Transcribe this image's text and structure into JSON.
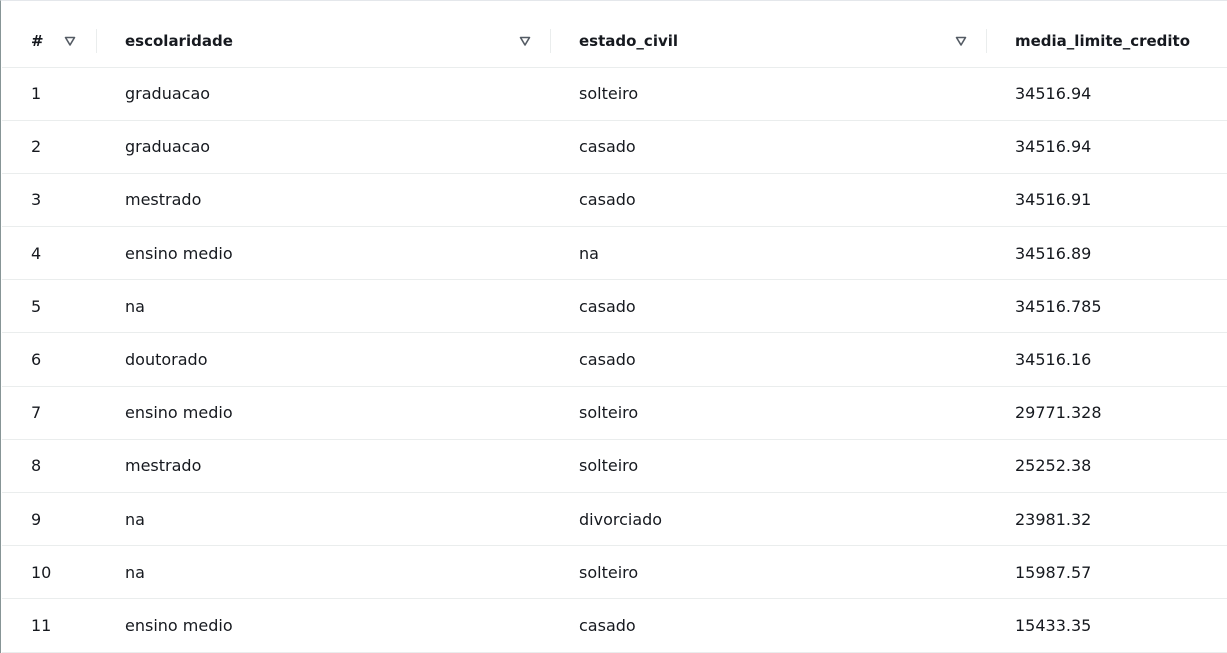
{
  "table": {
    "columns": [
      {
        "key": "num",
        "label": "#"
      },
      {
        "key": "escolaridade",
        "label": "escolaridade"
      },
      {
        "key": "estado_civil",
        "label": "estado_civil"
      },
      {
        "key": "media_limite_credito",
        "label": "media_limite_credito"
      }
    ],
    "sort_icon": "caret-down-outline-icon",
    "rows": [
      {
        "num": "1",
        "escolaridade": "graduacao",
        "estado_civil": "solteiro",
        "media_limite_credito": "34516.94"
      },
      {
        "num": "2",
        "escolaridade": "graduacao",
        "estado_civil": "casado",
        "media_limite_credito": "34516.94"
      },
      {
        "num": "3",
        "escolaridade": "mestrado",
        "estado_civil": "casado",
        "media_limite_credito": "34516.91"
      },
      {
        "num": "4",
        "escolaridade": "ensino medio",
        "estado_civil": "na",
        "media_limite_credito": "34516.89"
      },
      {
        "num": "5",
        "escolaridade": "na",
        "estado_civil": "casado",
        "media_limite_credito": "34516.785"
      },
      {
        "num": "6",
        "escolaridade": "doutorado",
        "estado_civil": "casado",
        "media_limite_credito": "34516.16"
      },
      {
        "num": "7",
        "escolaridade": "ensino medio",
        "estado_civil": "solteiro",
        "media_limite_credito": "29771.328"
      },
      {
        "num": "8",
        "escolaridade": "mestrado",
        "estado_civil": "solteiro",
        "media_limite_credito": "25252.38"
      },
      {
        "num": "9",
        "escolaridade": "na",
        "estado_civil": "divorciado",
        "media_limite_credito": "23981.32"
      },
      {
        "num": "10",
        "escolaridade": "na",
        "estado_civil": "solteiro",
        "media_limite_credito": "15987.57"
      },
      {
        "num": "11",
        "escolaridade": "ensino medio",
        "estado_civil": "casado",
        "media_limite_credito": "15433.35"
      }
    ]
  }
}
